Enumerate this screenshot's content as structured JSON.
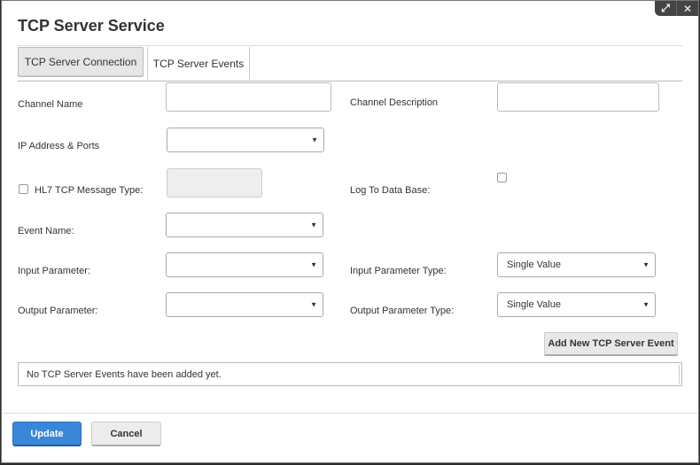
{
  "dialog": {
    "title": "TCP Server Service",
    "controls": {
      "expand_icon": "expand-icon",
      "close_icon": "close-icon"
    }
  },
  "tabs": [
    {
      "label": "TCP Server Connection",
      "active": true
    },
    {
      "label": "TCP Server Events",
      "active": false
    }
  ],
  "form": {
    "channel_name": {
      "label": "Channel Name",
      "value": ""
    },
    "channel_description": {
      "label": "Channel Description",
      "value": ""
    },
    "ip_address_ports": {
      "label": "IP Address & Ports",
      "selected": ""
    },
    "hl7_tcp_message_type": {
      "label": "HL7 TCP Message Type:",
      "checked": false,
      "value": ""
    },
    "log_to_database": {
      "label": "Log To Data Base:",
      "checked": false
    },
    "event_name": {
      "label": "Event Name:",
      "selected": ""
    },
    "input_parameter": {
      "label": "Input Parameter:",
      "selected": ""
    },
    "input_parameter_type": {
      "label": "Input Parameter Type:",
      "selected": "Single Value"
    },
    "output_parameter": {
      "label": "Output Parameter:",
      "selected": ""
    },
    "output_parameter_type": {
      "label": "Output Parameter Type:",
      "selected": "Single Value"
    }
  },
  "events": {
    "add_button_label": "Add New TCP Server Event",
    "empty_message": "No TCP Server Events have been added yet."
  },
  "footer": {
    "update_label": "Update",
    "cancel_label": "Cancel"
  },
  "colors": {
    "primary": "#3a87d9"
  }
}
